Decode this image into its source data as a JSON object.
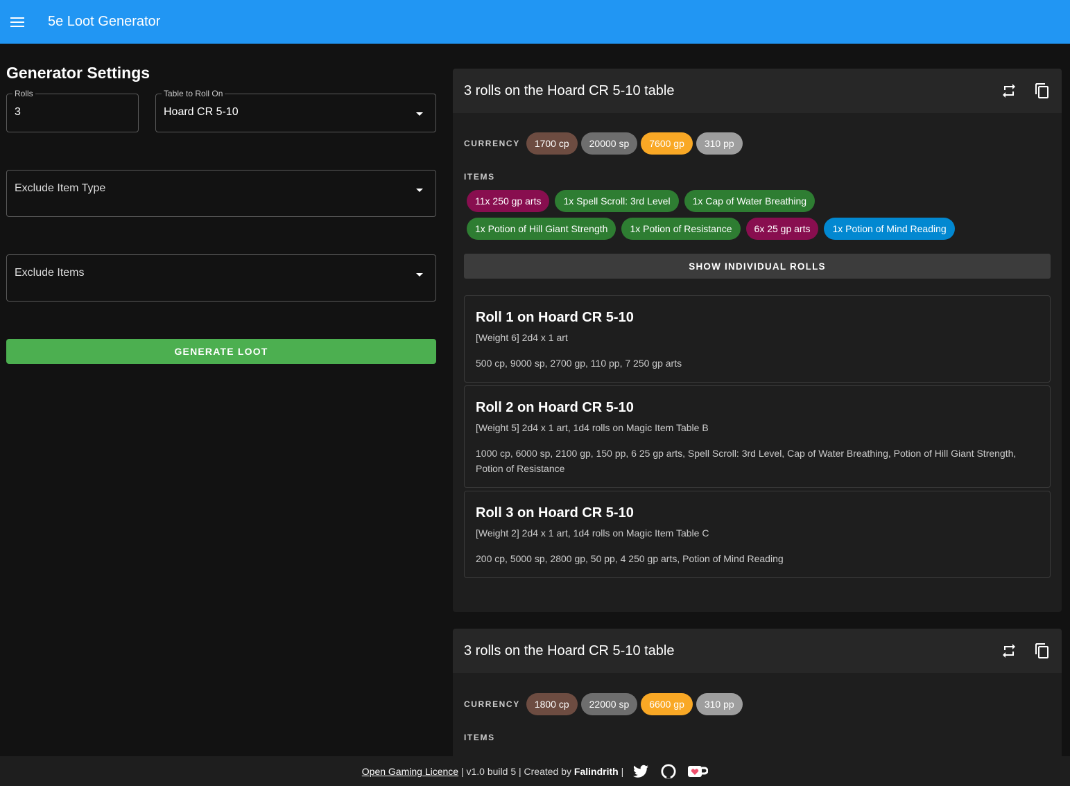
{
  "app": {
    "title": "5e Loot Generator",
    "menu_icon": "hamburger-icon",
    "color": "#2196f3"
  },
  "settings": {
    "title": "Generator Settings",
    "rolls_label": "Rolls",
    "rolls_value": "3",
    "table_label": "Table to Roll On",
    "table_value": "Hoard CR 5-10",
    "exclude_type_placeholder": "Exclude Item Type",
    "exclude_items_placeholder": "Exclude Items",
    "generate_label": "GENERATE LOOT"
  },
  "results": [
    {
      "title": "3 rolls on the Hoard CR 5-10 table",
      "currency_label": "CURRENCY",
      "items_label": "ITEMS",
      "currency": [
        {
          "text": "1700 cp",
          "color": "#6d4c41"
        },
        {
          "text": "20000 sp",
          "color": "#6e6e6e"
        },
        {
          "text": "7600 gp",
          "color": "#f9a825"
        },
        {
          "text": "310 pp",
          "color": "#9e9e9e"
        }
      ],
      "items": [
        {
          "text": "11x 250 gp arts",
          "color": "#880e4f"
        },
        {
          "text": "1x Spell Scroll: 3rd Level",
          "color": "#2e7d32"
        },
        {
          "text": "1x Cap of Water Breathing",
          "color": "#2e7d32"
        },
        {
          "text": "1x Potion of Hill Giant Strength",
          "color": "#2e7d32"
        },
        {
          "text": "1x Potion of Resistance",
          "color": "#2e7d32"
        },
        {
          "text": "6x 25 gp arts",
          "color": "#880e4f"
        },
        {
          "text": "1x Potion of Mind Reading",
          "color": "#0288d1"
        }
      ],
      "show_label": "SHOW INDIVIDUAL ROLLS",
      "rolls": [
        {
          "title": "Roll 1 on Hoard CR 5-10",
          "weight": "[Weight 6] 2d4 x 1 art",
          "result": "500 cp, 9000 sp, 2700 gp, 110 pp, 7 250 gp arts"
        },
        {
          "title": "Roll 2 on Hoard CR 5-10",
          "weight": "[Weight 5] 2d4 x 1 art, 1d4 rolls on Magic Item Table B",
          "result": "1000 cp, 6000 sp, 2100 gp, 150 pp, 6 25 gp arts, Spell Scroll: 3rd Level, Cap of Water Breathing, Potion of Hill Giant Strength, Potion of Resistance"
        },
        {
          "title": "Roll 3 on Hoard CR 5-10",
          "weight": "[Weight 2] 2d4 x 1 art, 1d4 rolls on Magic Item Table C",
          "result": "200 cp, 5000 sp, 2800 gp, 50 pp, 4 250 gp arts, Potion of Mind Reading"
        }
      ]
    },
    {
      "title": "3 rolls on the Hoard CR 5-10 table",
      "currency_label": "CURRENCY",
      "items_label": "ITEMS",
      "currency": [
        {
          "text": "1800 cp",
          "color": "#6d4c41"
        },
        {
          "text": "22000 sp",
          "color": "#6e6e6e"
        },
        {
          "text": "6600 gp",
          "color": "#f9a825"
        },
        {
          "text": "310 pp",
          "color": "#9e9e9e"
        }
      ]
    }
  ],
  "footer": {
    "licence": "Open Gaming Licence",
    "version": " | v1.0 build 5 | Created by ",
    "author": "Falindrith",
    "sep": " |",
    "icons": [
      "twitter-icon",
      "github-icon",
      "kofi-icon"
    ]
  }
}
